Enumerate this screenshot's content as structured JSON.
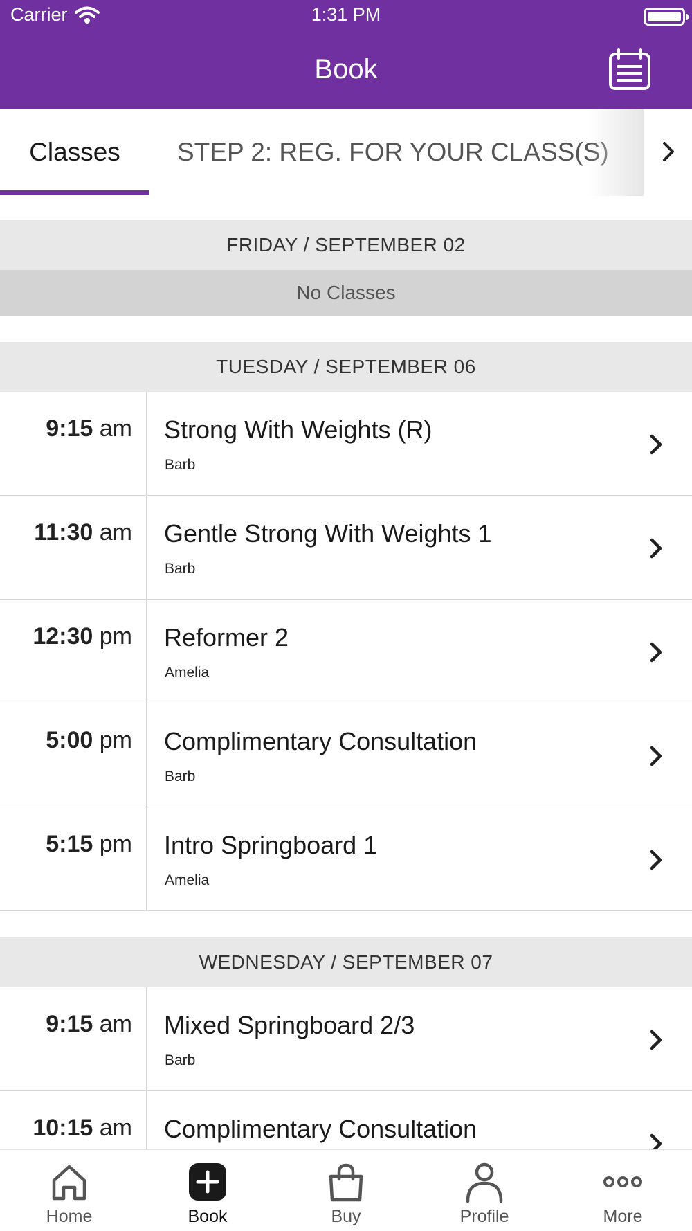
{
  "status_bar": {
    "carrier": "Carrier",
    "time": "1:31 PM"
  },
  "header": {
    "title": "Book",
    "calendar_icon": "calendar-icon"
  },
  "tabs": [
    {
      "label": "Classes",
      "active": true
    },
    {
      "label": "STEP 2: REG. FOR YOUR CLASS(S)",
      "active": false
    }
  ],
  "colors": {
    "brand": "#7030a0",
    "day_header_bg": "#e8e8e8",
    "no_classes_bg": "#d3d3d3"
  },
  "days": [
    {
      "label": "FRIDAY / SEPTEMBER 02",
      "empty_text": "No Classes",
      "classes": []
    },
    {
      "label": "TUESDAY / SEPTEMBER 06",
      "classes": [
        {
          "time": "9:15",
          "ampm": "am",
          "name": "Strong With Weights (R)",
          "instructor": "Barb"
        },
        {
          "time": "11:30",
          "ampm": "am",
          "name": "Gentle Strong With Weights 1",
          "instructor": "Barb"
        },
        {
          "time": "12:30",
          "ampm": "pm",
          "name": "Reformer 2",
          "instructor": "Amelia"
        },
        {
          "time": "5:00",
          "ampm": "pm",
          "name": "Complimentary Consultation",
          "instructor": "Barb"
        },
        {
          "time": "5:15",
          "ampm": "pm",
          "name": "Intro Springboard 1",
          "instructor": "Amelia"
        }
      ]
    },
    {
      "label": "WEDNESDAY / SEPTEMBER 07",
      "classes": [
        {
          "time": "9:15",
          "ampm": "am",
          "name": "Mixed Springboard 2/3",
          "instructor": "Barb"
        },
        {
          "time": "10:15",
          "ampm": "am",
          "name": "Complimentary Consultation",
          "instructor": ""
        }
      ]
    }
  ],
  "bottom_nav": [
    {
      "label": "Home",
      "icon": "home-icon",
      "active": false
    },
    {
      "label": "Book",
      "icon": "plus-icon",
      "active": true
    },
    {
      "label": "Buy",
      "icon": "shopping-bag-icon",
      "active": false
    },
    {
      "label": "Profile",
      "icon": "person-icon",
      "active": false
    },
    {
      "label": "More",
      "icon": "more-icon",
      "active": false
    }
  ]
}
